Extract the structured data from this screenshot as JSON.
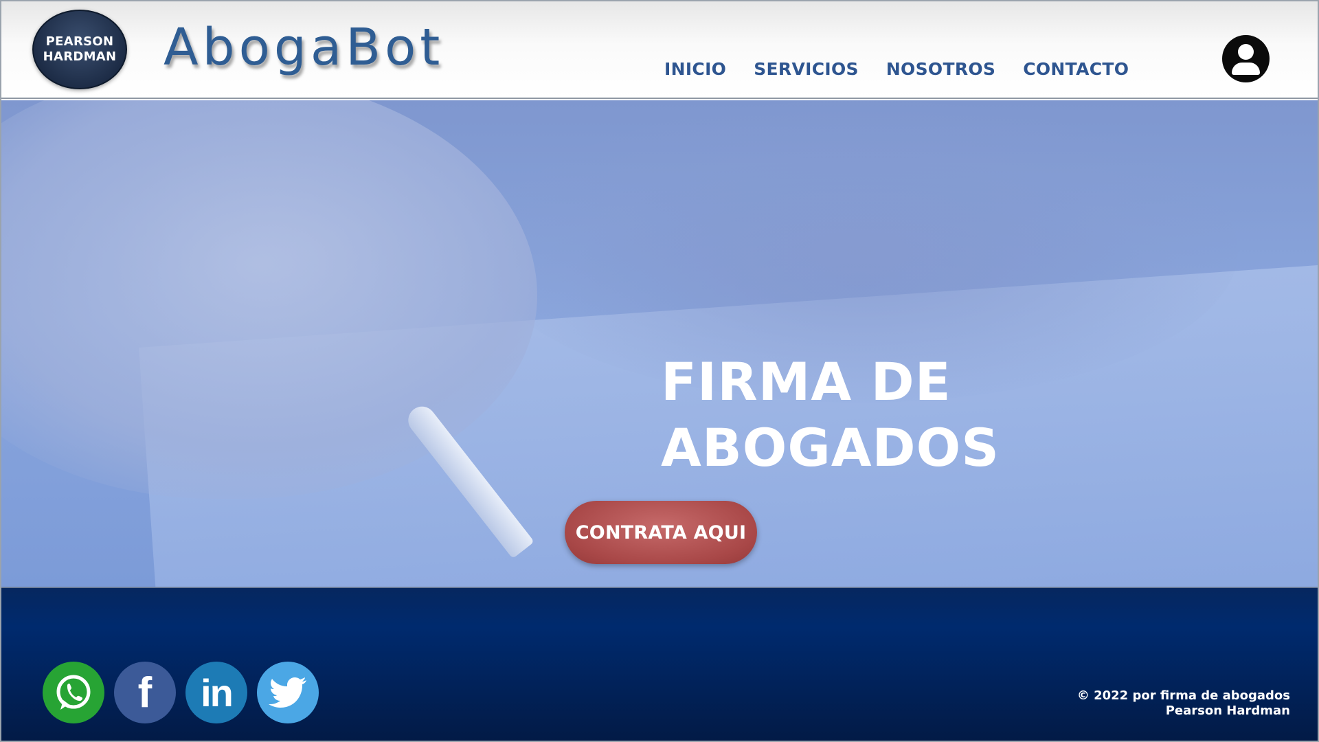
{
  "header": {
    "logo_line1": "PEARSON",
    "logo_line2": "HARDMAN",
    "brand": "AbogaBot",
    "nav": [
      {
        "label": "INICIO"
      },
      {
        "label": "SERVICIOS"
      },
      {
        "label": "NOSOTROS"
      },
      {
        "label": "CONTACTO"
      }
    ],
    "user_icon": "user-account-icon"
  },
  "hero": {
    "title_line1": "FIRMA DE",
    "title_line2": "ABOGADOS",
    "cta_label": "CONTRATA AQUI"
  },
  "footer": {
    "social": [
      {
        "name": "whatsapp-icon",
        "color": "#27a434"
      },
      {
        "name": "facebook-icon",
        "color": "#3c5a98"
      },
      {
        "name": "linkedin-icon",
        "color": "#1d7bb5"
      },
      {
        "name": "twitter-icon",
        "color": "#4ba7e5"
      }
    ],
    "copyright_line1": "© 2022 por firma de abogados",
    "copyright_line2": "Pearson Hardman"
  },
  "colors": {
    "brand_blue": "#2f5d93",
    "nav_blue": "#2e5590",
    "cta_red": "#a94848",
    "footer_navy": "#002a6e"
  }
}
